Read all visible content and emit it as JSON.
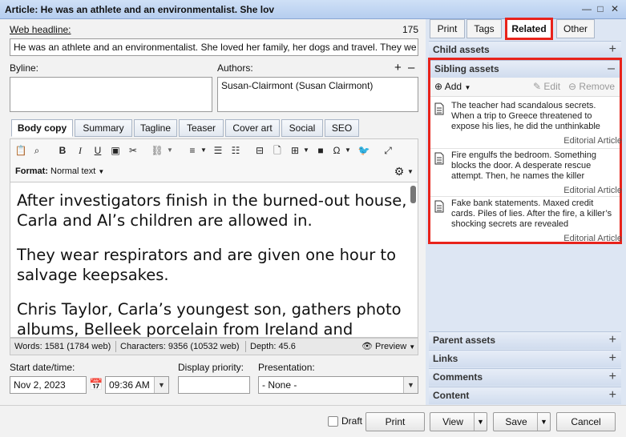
{
  "window": {
    "title": "Article: He was an athlete and an environmentalist. She lov",
    "buttons": {
      "minimize": "—",
      "maximize": "□",
      "close": "✕"
    }
  },
  "form": {
    "web_headline_label": "Web headline:",
    "web_headline_count": "175",
    "web_headline_value": "He was an athlete and an environmentalist. She loved her family, her dogs and travel. They we",
    "byline_label": "Byline:",
    "authors_label": "Authors:",
    "authors_add": "+",
    "authors_remove": "–",
    "author_item": "Susan-Clairmont (Susan Clairmont)"
  },
  "editor_tabs": [
    "Body copy",
    "Summary",
    "Tagline",
    "Teaser",
    "Cover art",
    "Social",
    "SEO"
  ],
  "toolbar": {
    "format_label": "Format:",
    "format_value": "Normal text"
  },
  "body_paragraphs": [
    "After investigators finish in the burned-out house, Carla and Al’s children are allowed in.",
    "They wear respirators and are given one hour to salvage keepsakes.",
    "Chris Taylor, Carla’s youngest son, gathers photo albums, Belleek porcelain from Ireland and"
  ],
  "status": {
    "words": "Words: 1581 (1784 web)",
    "characters": "Characters: 9356 (10532 web)",
    "depth": "Depth: 45.6",
    "preview": "Preview"
  },
  "schedule": {
    "start_label": "Start date/time:",
    "date_value": "Nov 2, 2023",
    "time_value": "09:36 AM",
    "priority_label": "Display priority:",
    "presentation_label": "Presentation:",
    "presentation_value": "- None -"
  },
  "right_tabs": [
    "Print",
    "Tags",
    "Related",
    "Other"
  ],
  "sections": {
    "child_assets": "Child assets",
    "sibling_assets": "Sibling assets",
    "parent_assets": "Parent assets",
    "links": "Links",
    "comments": "Comments",
    "content": "Content",
    "plus": "+",
    "minus": "–"
  },
  "sibling_actions": {
    "add": "Add",
    "edit": "Edit",
    "remove": "Remove"
  },
  "sibling_assets": [
    {
      "text": "The teacher had scandalous secrets. When a trip to Greece threatened to expose his lies, he did the unthinkable",
      "type": "Editorial Article"
    },
    {
      "text": "Fire engulfs the bedroom. Something blocks the door. A desperate rescue attempt. Then, he names the killer",
      "type": "Editorial Article"
    },
    {
      "text": "Fake bank statements. Maxed credit cards. Piles of lies. After the fire, a killer’s shocking secrets are revealed",
      "type": "Editorial Article"
    }
  ],
  "bottom": {
    "draft": "Draft",
    "print": "Print",
    "view": "View",
    "save": "Save",
    "cancel": "Cancel"
  }
}
